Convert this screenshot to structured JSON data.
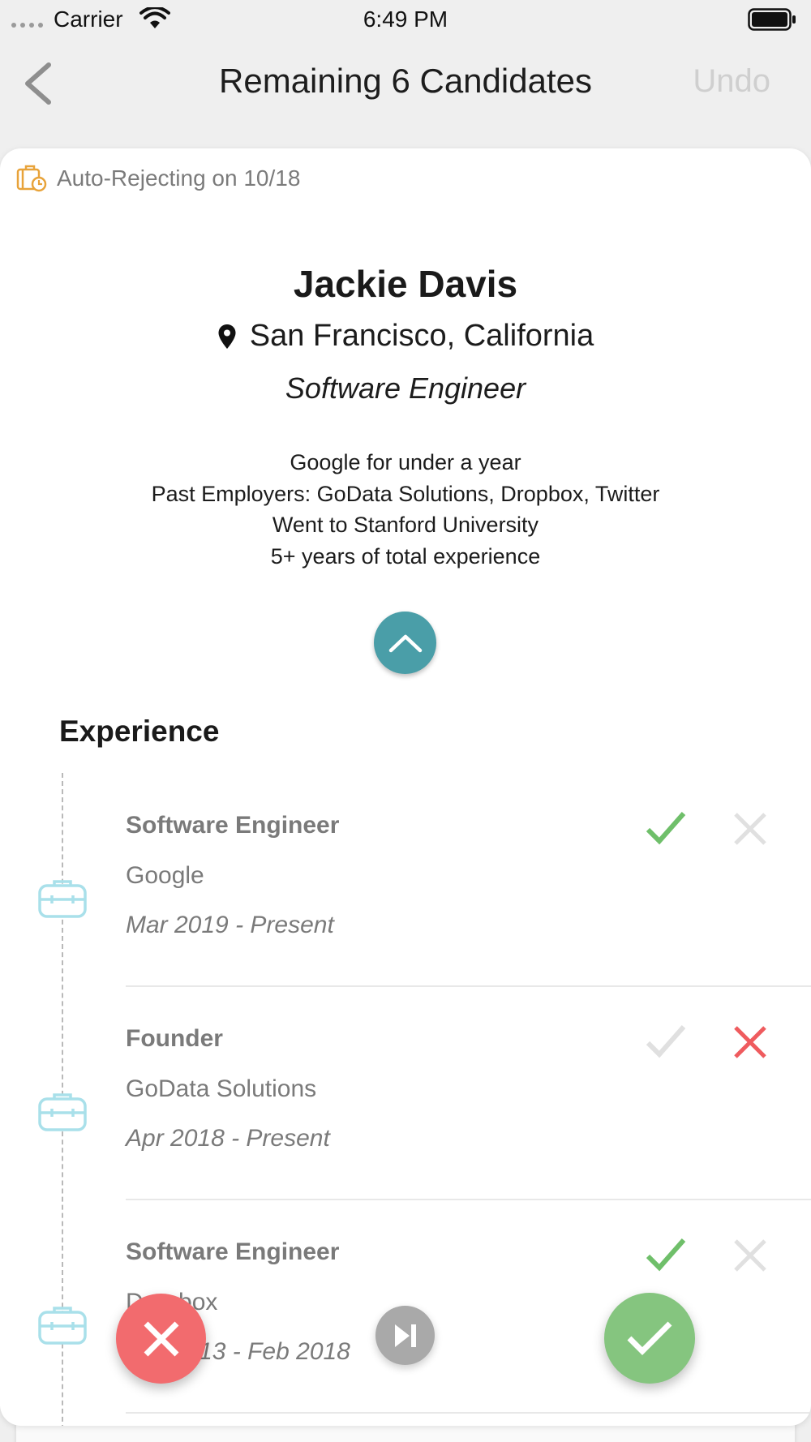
{
  "status_bar": {
    "carrier": "Carrier",
    "time": "6:49 PM"
  },
  "nav": {
    "title": "Remaining 6 Candidates",
    "undo_label": "Undo"
  },
  "card": {
    "auto_reject": "Auto-Rejecting on 10/18",
    "name": "Jackie Davis",
    "location": "San Francisco, California",
    "role": "Software Engineer",
    "summary": [
      "Google for under a year",
      "Past Employers: GoData Solutions, Dropbox, Twitter",
      "Went to Stanford University",
      "5+ years of total experience"
    ],
    "experience_title": "Experience",
    "jobs": [
      {
        "title": "Software Engineer",
        "company": "Google",
        "dates": "Mar 2019 - Present",
        "state": "accepted"
      },
      {
        "title": "Founder",
        "company": "GoData Solutions",
        "dates": "Apr 2018 - Present",
        "state": "rejected"
      },
      {
        "title": "Software Engineer",
        "company": "Dropbox",
        "dates": "Jun 2013 - Feb 2018",
        "state": "accepted"
      }
    ]
  },
  "colors": {
    "accent_teal": "#4a9ea8",
    "accept_green": "#6fbf6a",
    "reject_red": "#ef5b5e",
    "auto_reject_orange": "#e8a33a",
    "timeline_icon": "#a9e0ea"
  },
  "icons": {
    "back": "chevron-left-icon",
    "auto_reject": "briefcase-clock-icon",
    "location": "map-pin-icon",
    "collapse": "chevron-up-icon",
    "job": "briefcase-icon",
    "accept": "check-icon",
    "reject": "x-icon",
    "skip": "skip-next-icon"
  }
}
